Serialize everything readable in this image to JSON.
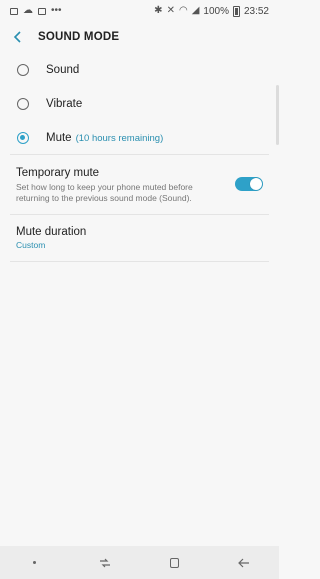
{
  "status_bar": {
    "battery_percent": "100%",
    "time": "23:52",
    "left_icons": [
      "image-icon",
      "cloud-icon",
      "message-icon",
      "more-icon"
    ],
    "right_icons": [
      "bluetooth-icon",
      "mute-icon",
      "wifi-icon",
      "signal-icon",
      "battery-icon"
    ]
  },
  "app_bar": {
    "title": "SOUND MODE",
    "back_icon": "back-arrow-icon"
  },
  "modes": [
    {
      "label": "Sound",
      "selected": false
    },
    {
      "label": "Vibrate",
      "selected": false
    },
    {
      "label": "Mute",
      "selected": true,
      "sublabel": "(10 hours remaining)"
    }
  ],
  "temporary_mute": {
    "title": "Temporary mute",
    "description": "Set how long to keep your phone muted before returning to the previous sound mode (Sound).",
    "enabled": true
  },
  "mute_duration": {
    "title": "Mute duration",
    "value": "Custom"
  },
  "colors": {
    "accent": "#2ea1c8",
    "background": "#f7f7f7"
  },
  "nav_bar": [
    "dot-icon",
    "recent-apps-icon",
    "home-icon",
    "back-icon"
  ]
}
